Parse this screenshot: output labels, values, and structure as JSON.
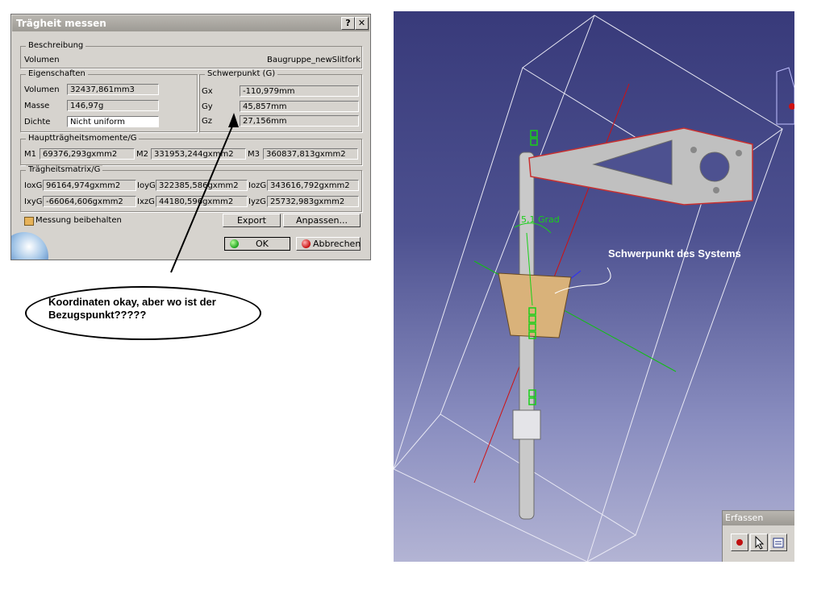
{
  "dialog": {
    "title": "Trägheit messen",
    "help_btn": "?",
    "close_btn": "✕",
    "beschreibung": {
      "legend": "Beschreibung",
      "left": "Volumen",
      "right": "Baugruppe_newSlitfork"
    },
    "eigenschaften": {
      "legend": "Eigenschaften",
      "rows": [
        {
          "label": "Volumen",
          "value": "32437,861mm3"
        },
        {
          "label": "Masse",
          "value": "146,97g"
        },
        {
          "label": "Dichte",
          "value": "Nicht uniform"
        }
      ]
    },
    "schwerpunkt": {
      "legend": "Schwerpunkt (G)",
      "rows": [
        {
          "label": "Gx",
          "value": "-110,979mm"
        },
        {
          "label": "Gy",
          "value": "45,857mm"
        },
        {
          "label": "Gz",
          "value": "27,156mm"
        }
      ]
    },
    "haupt": {
      "legend": "Hauptträgheitsmomente/G",
      "items": [
        {
          "label": "M1",
          "value": "69376,293gxmm2"
        },
        {
          "label": "M2",
          "value": "331953,244gxmm2"
        },
        {
          "label": "M3",
          "value": "360837,813gxmm2"
        }
      ]
    },
    "matrix": {
      "legend": "Trägheitsmatrix/G",
      "row1": [
        {
          "label": "IoxG",
          "value": "96164,974gxmm2"
        },
        {
          "label": "IoyG",
          "value": "322385,586gxmm2"
        },
        {
          "label": "IozG",
          "value": "343616,792gxmm2"
        }
      ],
      "row2": [
        {
          "label": "IxyG",
          "value": "-66064,606gxmm2"
        },
        {
          "label": "IxzG",
          "value": "44180,596gxmm2"
        },
        {
          "label": "IyzG",
          "value": "25732,983gxmm2"
        }
      ]
    },
    "keep_label": "Messung beibehalten",
    "export_btn": "Export",
    "anpassen_btn": "Anpassen...",
    "ok_btn": "OK",
    "cancel_btn": "Abbrechen"
  },
  "callout": {
    "line1": "Koordinaten okay, aber wo ist der",
    "line2": "Bezugspunkt?????"
  },
  "viewport": {
    "label": "Schwerpunkt des Systems",
    "angle_label": "5,1 Grad",
    "erfassen_title": "Erfassen",
    "colors": {
      "bg_top": "#383a7a",
      "bg_bottom": "#b3b4d4",
      "axis_red": "#d01010",
      "axis_green": "#10c010",
      "part": "#b8b8b8",
      "saddle": "#d9b27a"
    }
  }
}
